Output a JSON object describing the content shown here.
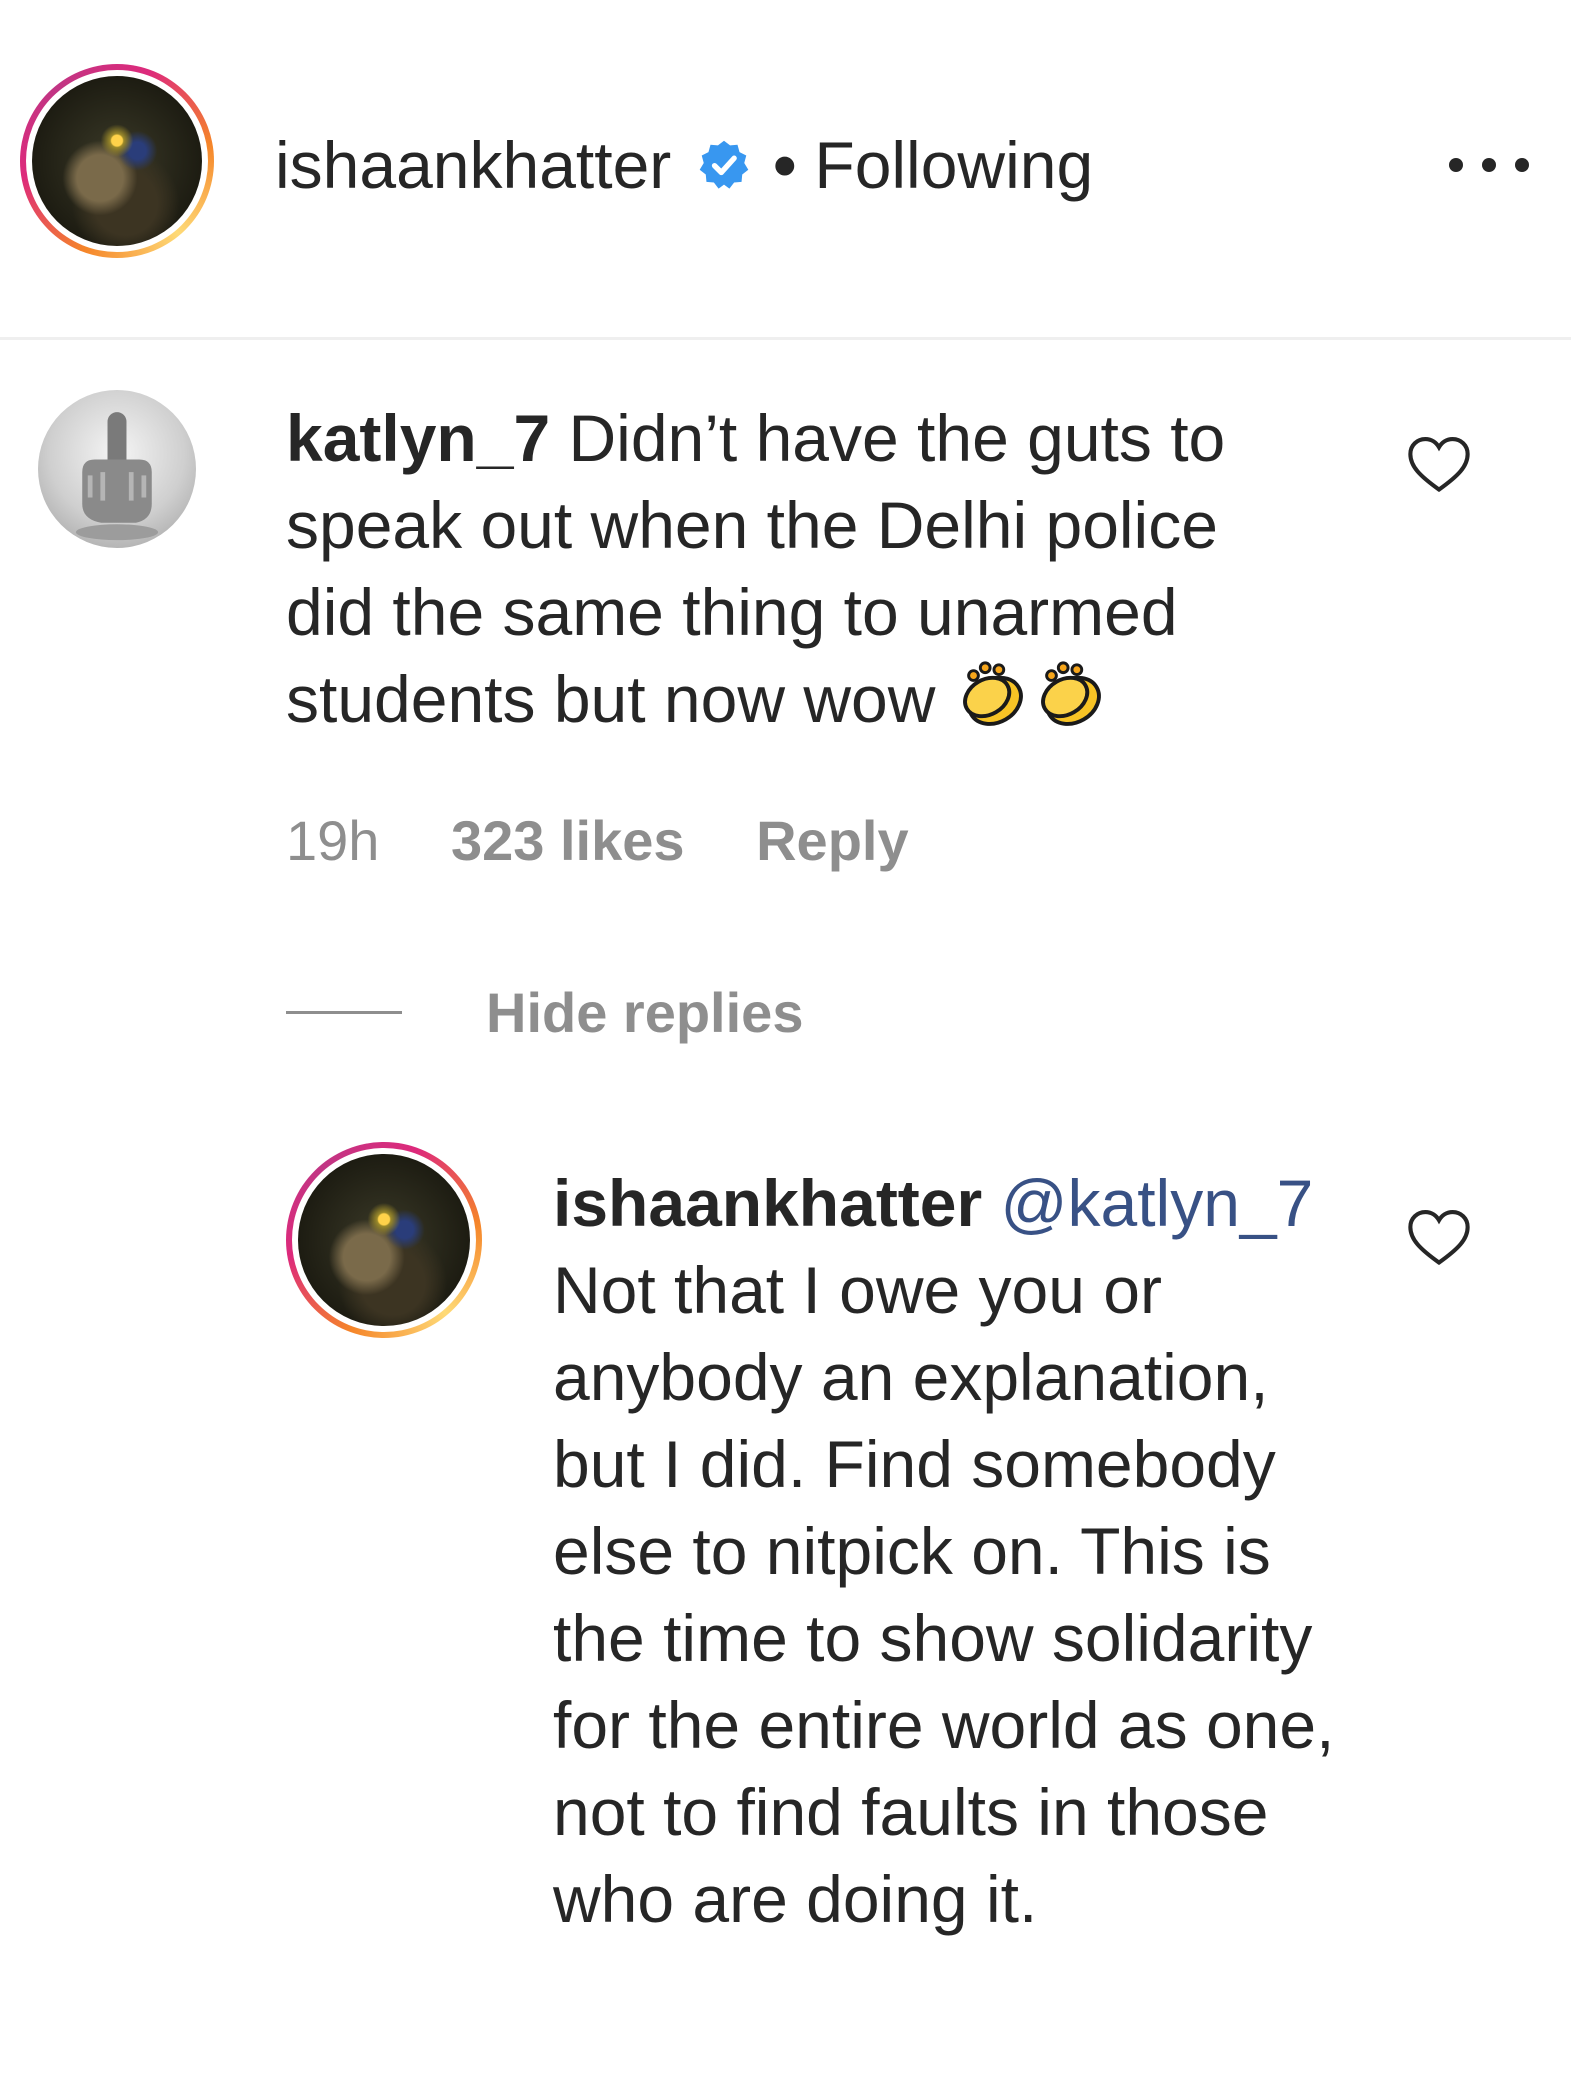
{
  "header": {
    "username": "ishaankhatter",
    "separator": "•",
    "follow_status": "Following",
    "icons": [
      "avatar",
      "verified-badge-icon",
      "more-options-icon"
    ]
  },
  "comment": {
    "username": "katlyn_7",
    "text": "Didn’t have the guts to speak out when the Delhi police did the same thing to unarmed students but now wow",
    "emoji": [
      "clapping-hands-icon",
      "clapping-hands-icon"
    ],
    "time": "19h",
    "likes": "323 likes",
    "reply_label": "Reply",
    "hide_replies_label": "Hide replies"
  },
  "reply": {
    "username": "ishaankhatter",
    "mention": "@katlyn_7",
    "text": "Not that I owe you or anybody an explanation, but I did. Find somebody else to nitpick on. This is the time to show solidarity for the entire world as one, not to find faults in those who are doing it."
  },
  "colors": {
    "text": "#262626",
    "muted": "#8e8e8e",
    "mention": "#385185",
    "verified": "#3897f0",
    "divider": "#efefef"
  }
}
